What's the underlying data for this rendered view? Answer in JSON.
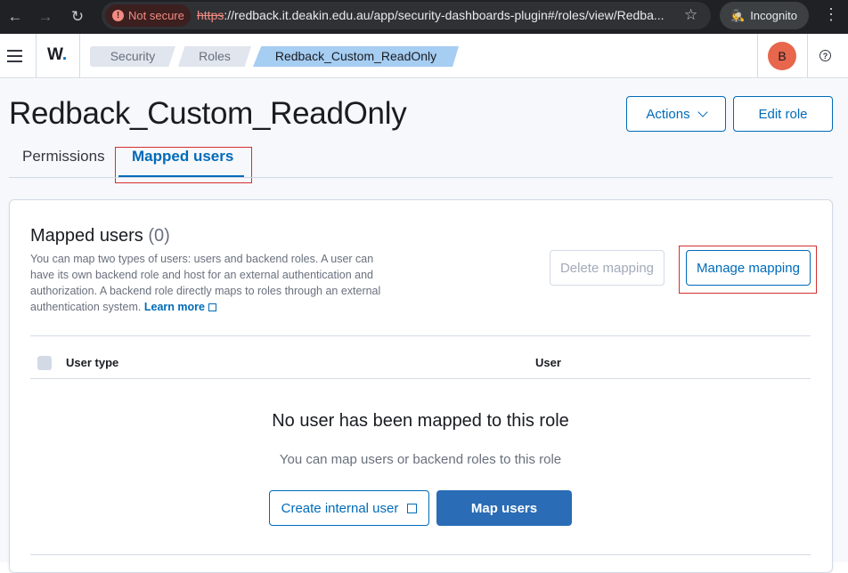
{
  "browser": {
    "not_secure_label": "Not secure",
    "url_scheme": "https",
    "url_rest": "://redback.it.deakin.edu.au/app/security-dashboards-plugin#/roles/view/Redba...",
    "incognito_label": "Incognito"
  },
  "header": {
    "logo_letter": "W",
    "logo_dot": ".",
    "breadcrumbs": [
      "Security",
      "Roles",
      "Redback_Custom_ReadOnly"
    ],
    "avatar_initial": "B"
  },
  "page": {
    "title": "Redback_Custom_ReadOnly",
    "actions_label": "Actions",
    "edit_label": "Edit role",
    "tabs": [
      {
        "label": "Permissions",
        "active": false
      },
      {
        "label": "Mapped users",
        "active": true
      }
    ]
  },
  "panel": {
    "title": "Mapped users",
    "count": "(0)",
    "description": "You can map two types of users: users and backend roles. A user can have its own backend role and host for an external authentication and authorization. A backend role directly maps to roles through an external authentication system.",
    "learn_more": "Learn more",
    "delete_label": "Delete mapping",
    "manage_label": "Manage mapping",
    "columns": [
      "User type",
      "User"
    ],
    "empty_title": "No user has been mapped to this role",
    "empty_subtitle": "You can map users or backend roles to this role",
    "create_label": "Create internal user",
    "map_label": "Map users"
  },
  "colors": {
    "accent": "#006bb8",
    "primary_button": "#2a6cb5",
    "highlight_box": "#d32f2f",
    "avatar": "#e7664c"
  }
}
